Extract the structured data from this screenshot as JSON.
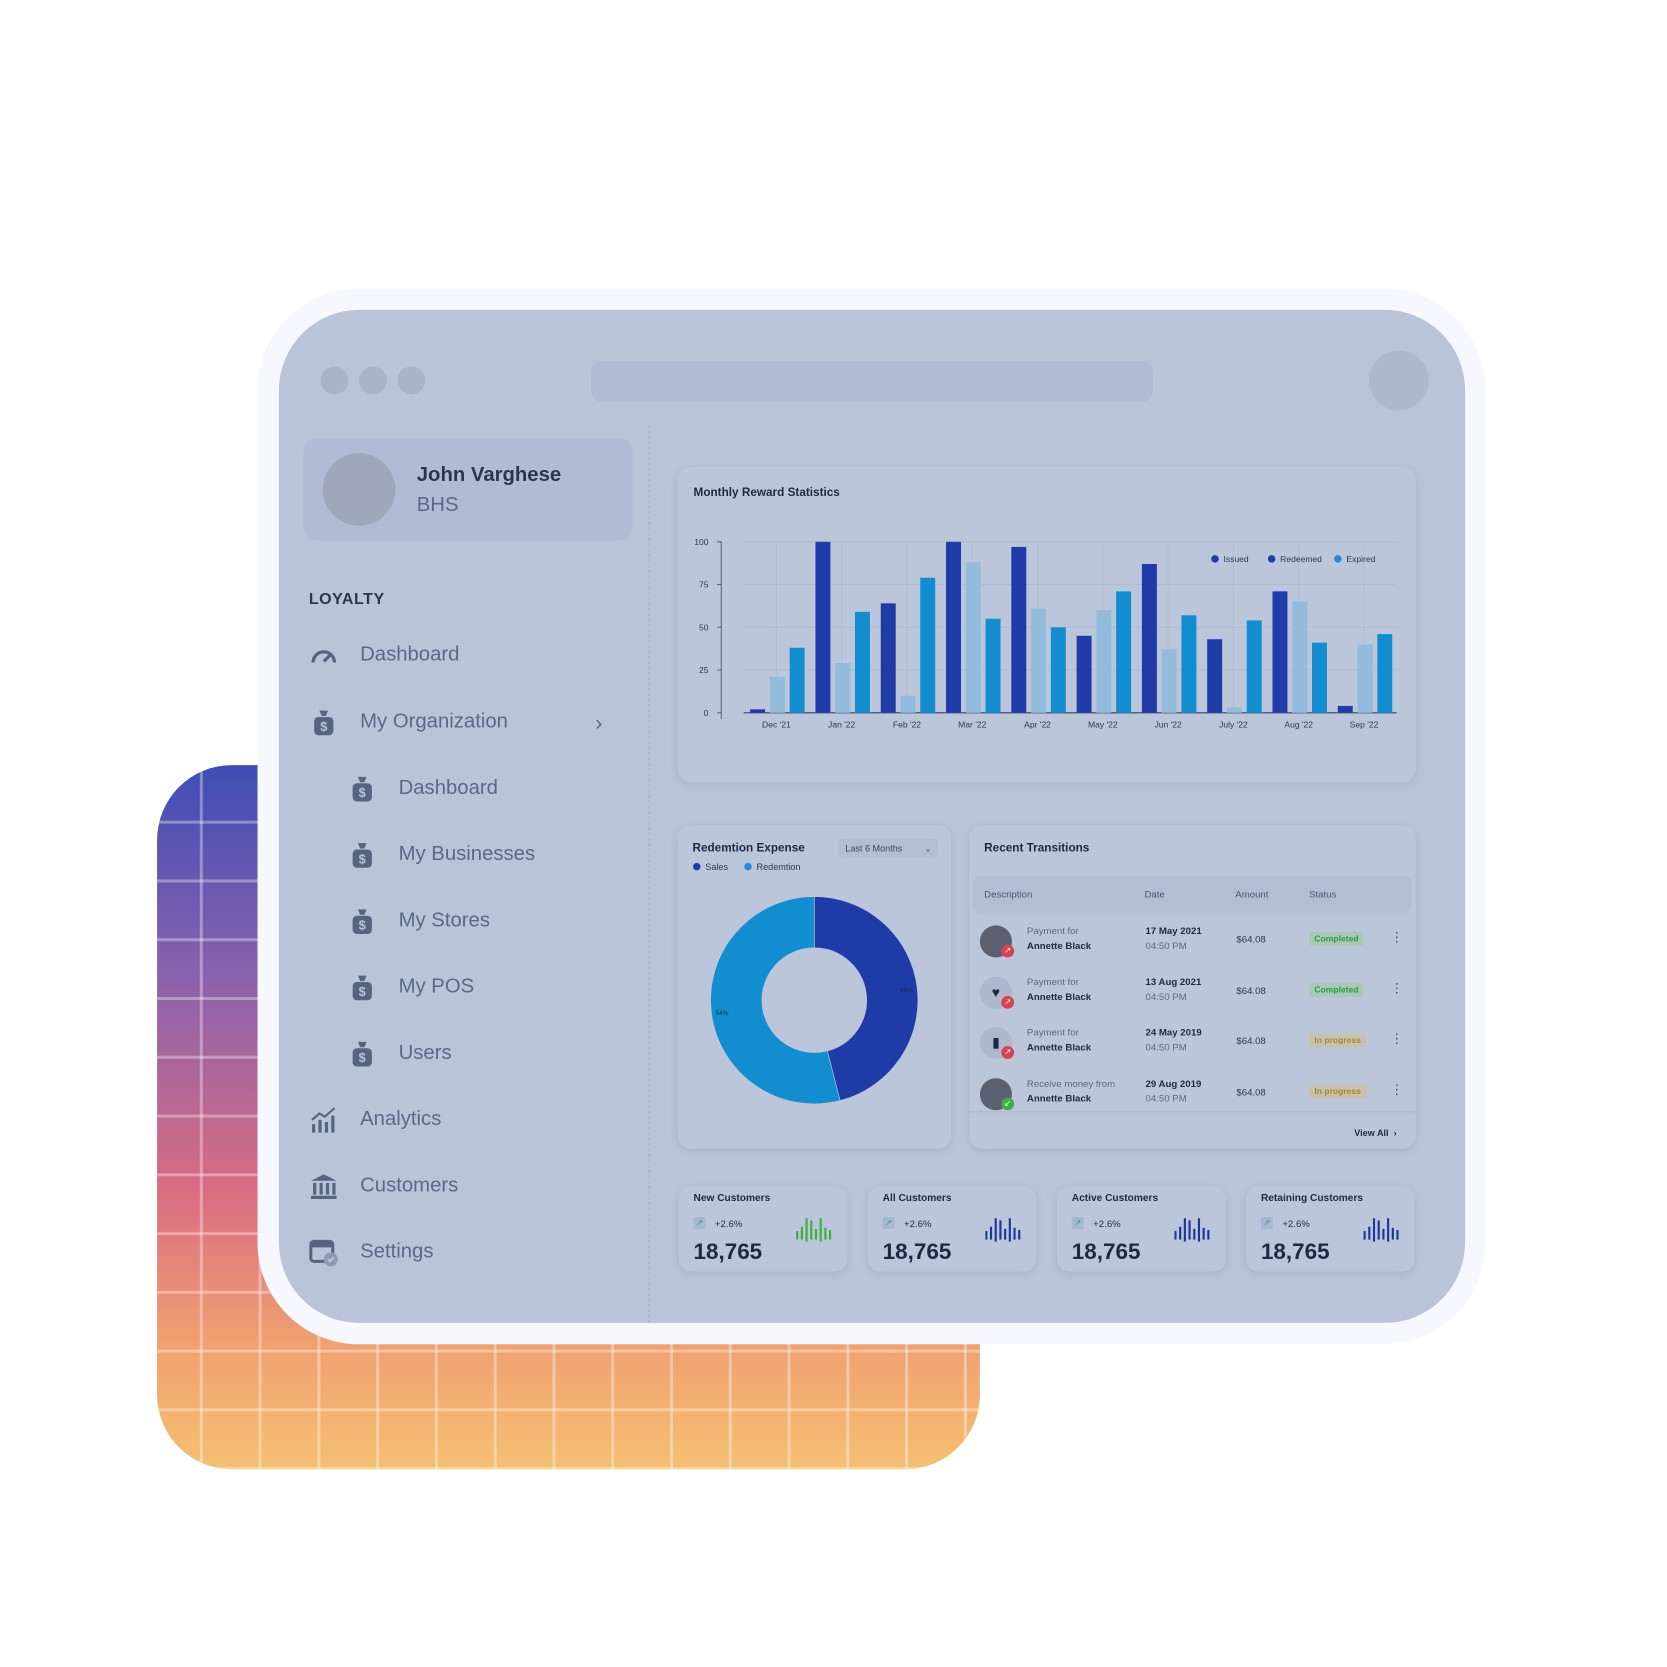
{
  "user": {
    "name": "John Varghese",
    "org": "BHS"
  },
  "sidebar": {
    "section": "LOYALTY",
    "items": [
      {
        "label": "Dashboard",
        "icon": "gauge-icon"
      },
      {
        "label": "My Organization",
        "icon": "money-bag-icon"
      },
      {
        "label": "Dashboard",
        "icon": "money-bag-icon"
      },
      {
        "label": "My Businesses",
        "icon": "money-bag-icon"
      },
      {
        "label": "My Stores",
        "icon": "money-bag-icon"
      },
      {
        "label": "My POS",
        "icon": "money-bag-icon"
      },
      {
        "label": "Users",
        "icon": "money-bag-icon"
      },
      {
        "label": "Analytics",
        "icon": "chart-icon"
      },
      {
        "label": "Customers",
        "icon": "bank-icon"
      },
      {
        "label": "Settings",
        "icon": "calendar-check-icon"
      }
    ]
  },
  "colors": {
    "issued": "#1f3ba8",
    "redeemed": "#93bbdc",
    "expired": "#128dd0",
    "completed": "#2e9a3e",
    "in_progress": "#a88a2a"
  },
  "chart_data": [
    {
      "type": "bar",
      "title": "Monthly Reward Statistics",
      "categories": [
        "Dec '21",
        "Jan '22",
        "Feb '22",
        "Mar '22",
        "Apr '22",
        "May '22",
        "Jun '22",
        "July '22",
        "Aug '22",
        "Sep '22"
      ],
      "ylim": [
        0,
        100
      ],
      "yticks": [
        0,
        25,
        50,
        75,
        100
      ],
      "grid": true,
      "legend": "top-right",
      "series": [
        {
          "name": "Issued",
          "values": [
            2,
            100,
            64,
            100,
            97,
            45,
            87,
            43,
            71,
            4
          ]
        },
        {
          "name": "Redeemed",
          "values": [
            21,
            29,
            10,
            88,
            61,
            60,
            37,
            3,
            65,
            40
          ]
        },
        {
          "name": "Expired",
          "values": [
            38,
            59,
            79,
            55,
            50,
            71,
            57,
            54,
            41,
            46
          ]
        }
      ]
    },
    {
      "type": "pie",
      "title": "Redemtion Expense",
      "filter": "Last 6 Months",
      "series": [
        {
          "name": "Sales",
          "value": 46,
          "label": "46%"
        },
        {
          "name": "Redemtion",
          "value": 54,
          "label": "54%"
        }
      ]
    }
  ],
  "transactions": {
    "title": "Recent Transitions",
    "headers": [
      "Description",
      "Date",
      "Amount",
      "Status"
    ],
    "view_all": "View All",
    "rows": [
      {
        "line1": "Payment for",
        "line2": "Annette Black",
        "date": "17 May 2021",
        "time": "04:50 PM",
        "amount": "$64.08",
        "status": "Completed",
        "dir": "out",
        "avatar": "photo"
      },
      {
        "line1": "Payment for",
        "line2": "Annette Black",
        "date": "13 Aug 2021",
        "time": "04:50 PM",
        "amount": "$64.08",
        "status": "Completed",
        "dir": "out",
        "avatar": "heart-icon"
      },
      {
        "line1": "Payment for",
        "line2": "Annette Black",
        "date": "24 May 2019",
        "time": "04:50 PM",
        "amount": "$64.08",
        "status": "In progress",
        "dir": "out",
        "avatar": "book-icon"
      },
      {
        "line1": "Receive money from",
        "line2": "Annette Black",
        "date": "29 Aug 2019",
        "time": "04:50 PM",
        "amount": "$64.08",
        "status": "In progress",
        "dir": "in",
        "avatar": "photo"
      }
    ]
  },
  "stats": [
    {
      "title": "New Customers",
      "change": "+2.6%",
      "value": "18,765",
      "color": "#3fae3f"
    },
    {
      "title": "All Customers",
      "change": "+2.6%",
      "value": "18,765",
      "color": "#1f3597"
    },
    {
      "title": "Active Customers",
      "change": "+2.6%",
      "value": "18,765",
      "color": "#1f3597"
    },
    {
      "title": "Retaining Customers",
      "change": "+2.6%",
      "value": "18,765",
      "color": "#1f3597"
    }
  ]
}
